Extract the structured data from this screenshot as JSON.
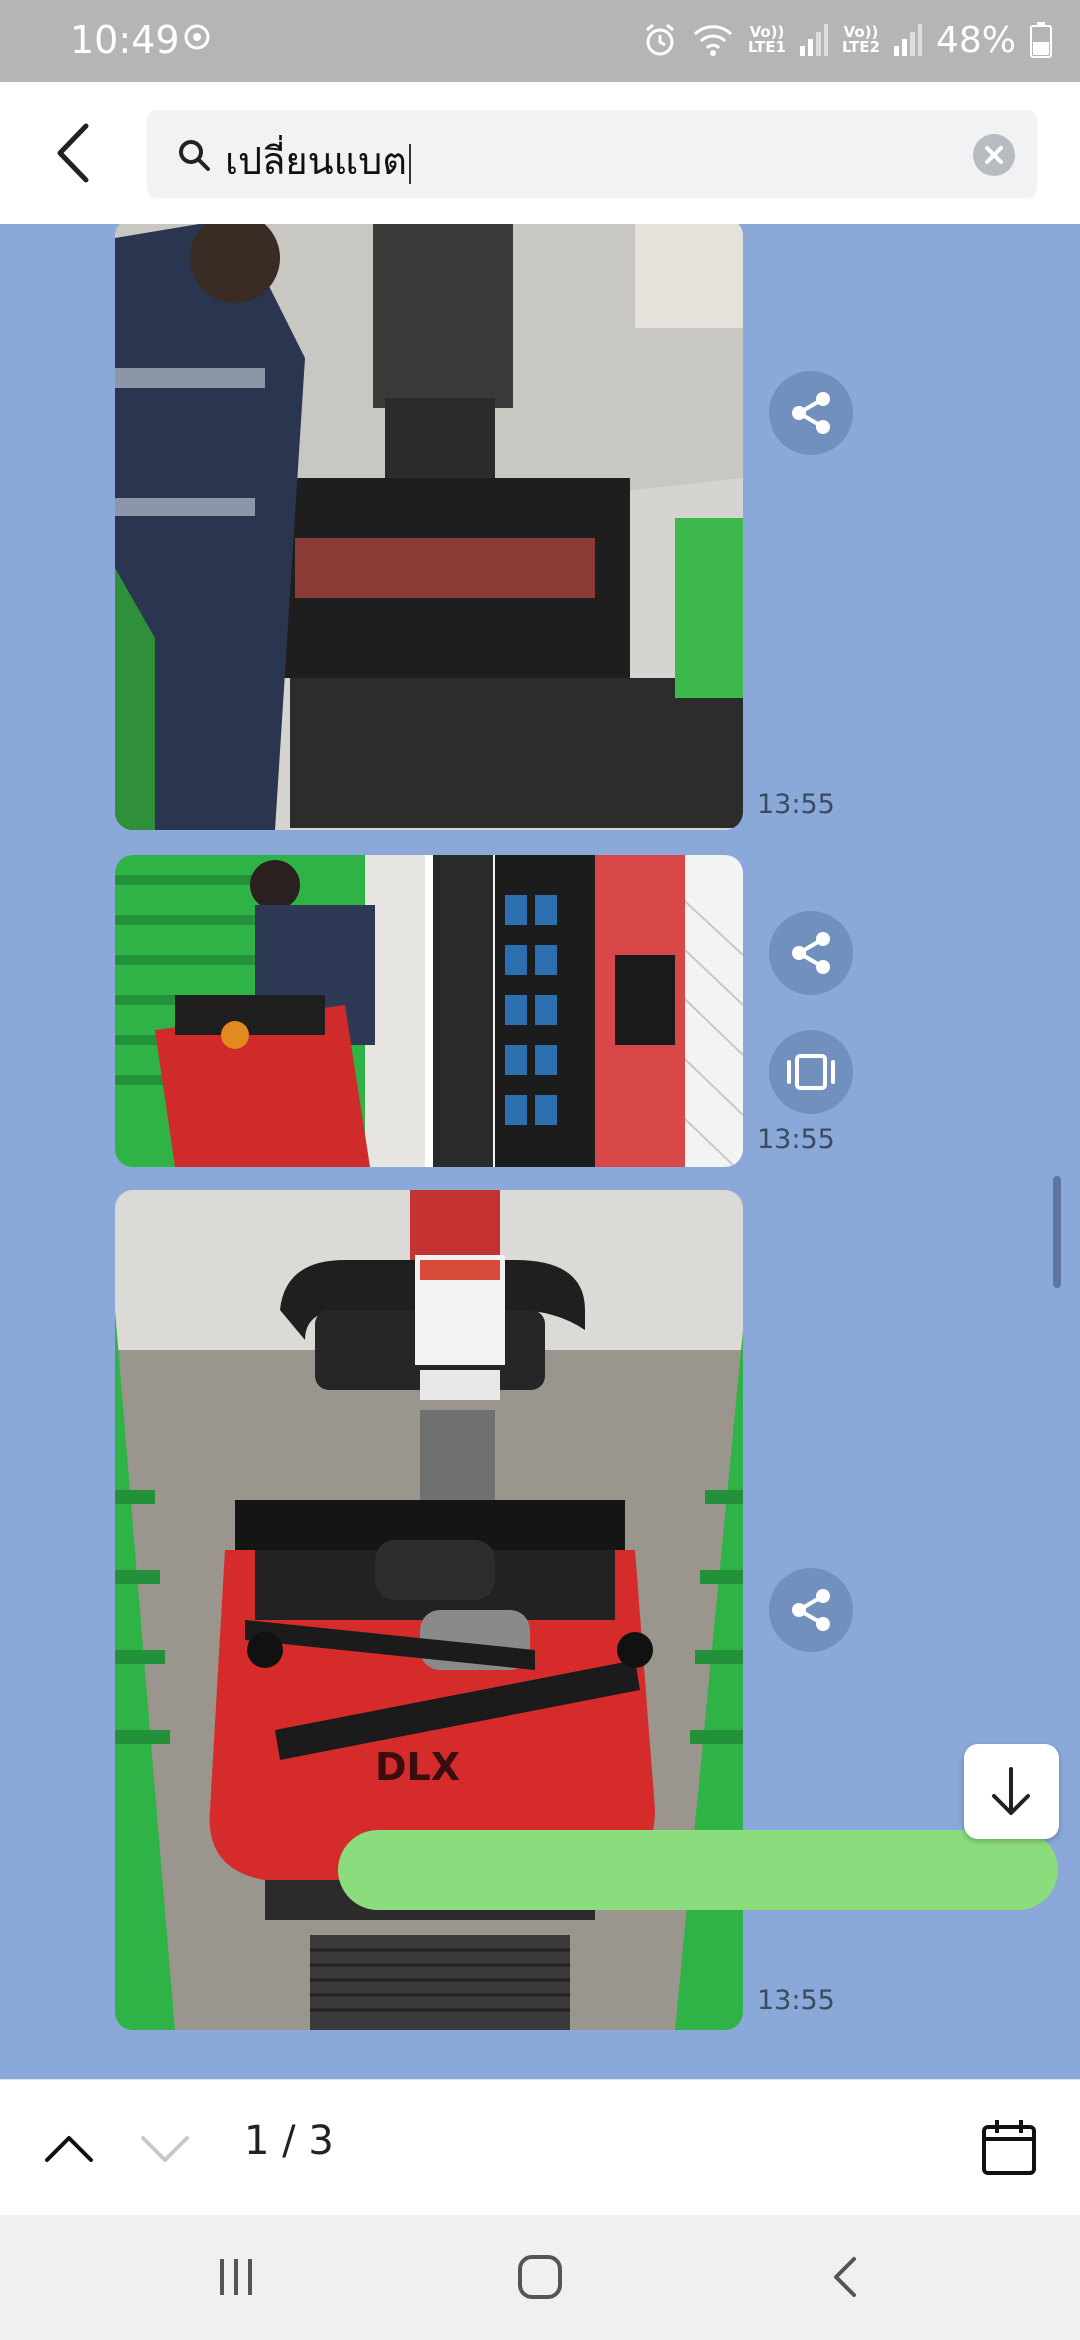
{
  "status": {
    "time": "10:49",
    "battery": "48%",
    "sim1": [
      "Vo))",
      "LTE1"
    ],
    "sim2": [
      "Vo))",
      "LTE2"
    ]
  },
  "search": {
    "query": "เปลี่ยนแบต"
  },
  "messages": [
    {
      "time": "13:55",
      "kind": "photo",
      "description": "worker-with-pallet-truck-handle"
    },
    {
      "time": "13:55",
      "kind": "album",
      "description": "battery-replacement-two-photos"
    },
    {
      "time": "13:55",
      "kind": "photo",
      "description": "red-electric-pallet-truck-top-view"
    }
  ],
  "result_counter": "1 / 3",
  "icons": {
    "back": "chevron-left-icon",
    "search": "search-icon",
    "clear": "clear-icon",
    "share": "share-icon",
    "album": "album-icon",
    "down": "arrow-down-icon",
    "prev": "chevron-up-icon",
    "next": "chevron-down-icon",
    "calendar": "calendar-icon"
  },
  "colors": {
    "chat_bg": "#8aa9d8",
    "share_bg": "#7290bd",
    "my_bubble": "#8bdc7c"
  }
}
